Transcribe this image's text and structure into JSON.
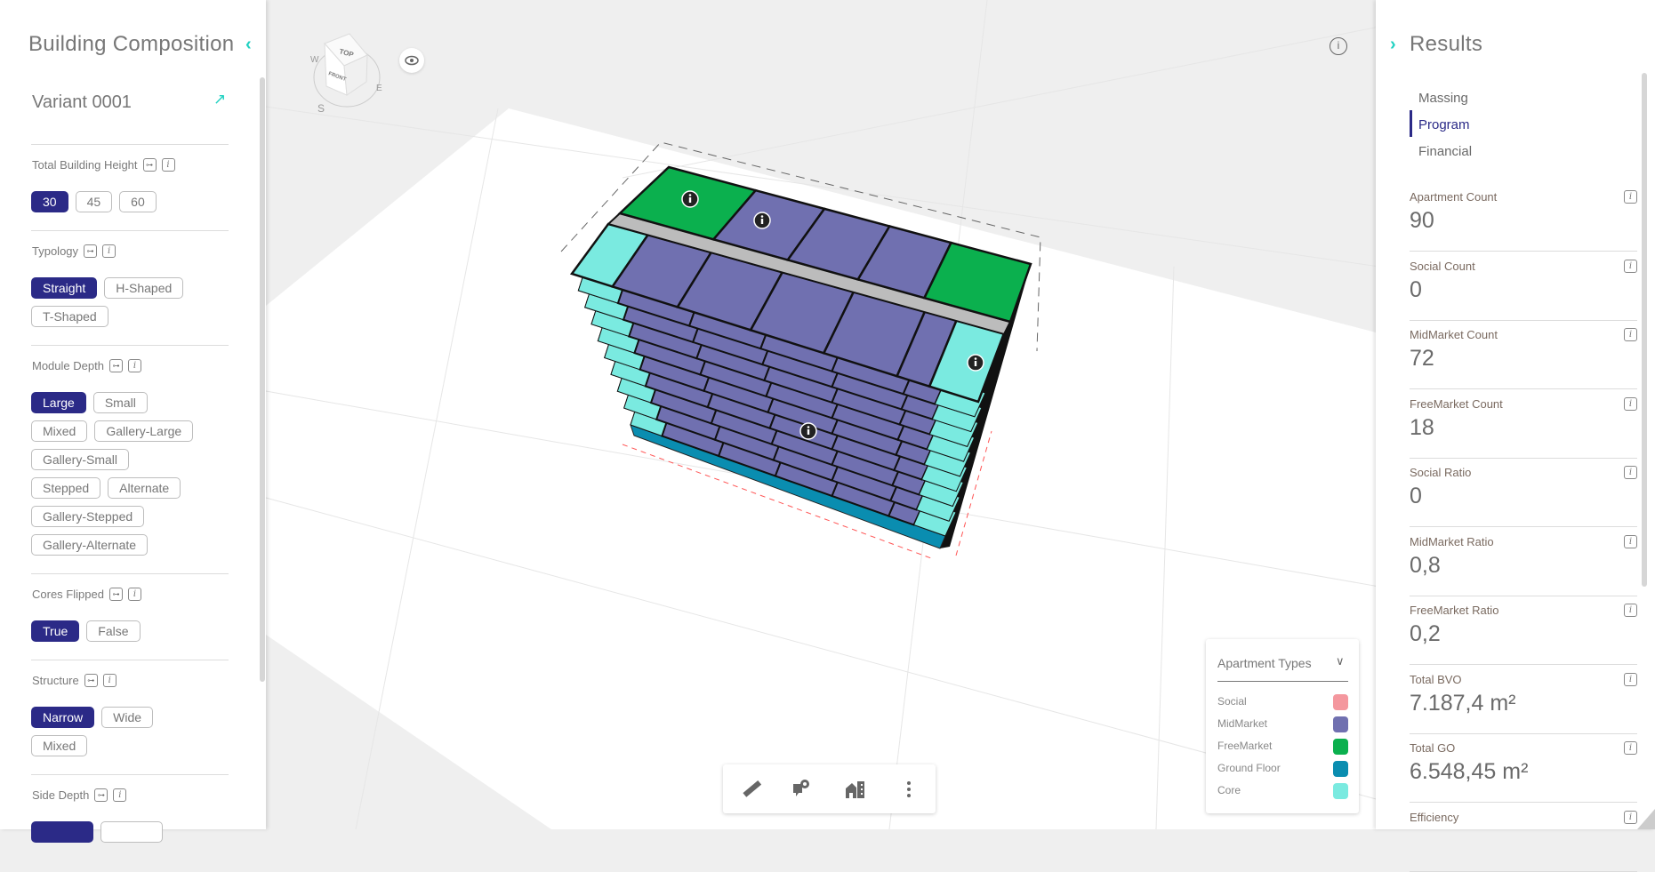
{
  "left_panel": {
    "title": "Building Composition",
    "variant": "Variant 0001",
    "sections": [
      {
        "label": "Total Building Height",
        "options": [
          "30",
          "45",
          "60"
        ],
        "selected": "30"
      },
      {
        "label": "Typology",
        "options": [
          "Straight",
          "H-Shaped",
          "T-Shaped"
        ],
        "selected": "Straight"
      },
      {
        "label": "Module Depth",
        "options": [
          "Large",
          "Small",
          "Mixed",
          "Gallery-Large",
          "Gallery-Small",
          "Stepped",
          "Alternate",
          "Gallery-Stepped",
          "Gallery-Alternate"
        ],
        "selected": "Large"
      },
      {
        "label": "Cores Flipped",
        "options": [
          "True",
          "False"
        ],
        "selected": "True"
      },
      {
        "label": "Structure",
        "options": [
          "Narrow",
          "Wide",
          "Mixed"
        ],
        "selected": "Narrow"
      },
      {
        "label": "Side Depth",
        "options": [
          "",
          ""
        ],
        "selected": ""
      }
    ]
  },
  "right_panel": {
    "title": "Results",
    "tabs": [
      "Massing",
      "Program",
      "Financial"
    ],
    "active_tab": "Program",
    "metrics": [
      {
        "label": "Apartment Count",
        "value": "90"
      },
      {
        "label": "Social Count",
        "value": "0"
      },
      {
        "label": "MidMarket Count",
        "value": "72"
      },
      {
        "label": "FreeMarket Count",
        "value": "18"
      },
      {
        "label": "Social Ratio",
        "value": "0"
      },
      {
        "label": "MidMarket Ratio",
        "value": "0,8"
      },
      {
        "label": "FreeMarket Ratio",
        "value": "0,2"
      },
      {
        "label": "Total BVO",
        "value": "7.187,4 m²"
      },
      {
        "label": "Total GO",
        "value": "6.548,45 m²"
      },
      {
        "label": "Efficiency",
        "value": ""
      }
    ]
  },
  "viewcube": {
    "top": "TOP",
    "front": "FRONT",
    "w": "W",
    "e": "E",
    "s": "S"
  },
  "legend": {
    "title": "Apartment Types",
    "items": [
      {
        "label": "Social",
        "color": "#f4979e"
      },
      {
        "label": "MidMarket",
        "color": "#7070b0"
      },
      {
        "label": "FreeMarket",
        "color": "#0bb04e"
      },
      {
        "label": "Ground Floor",
        "color": "#0a8db0"
      },
      {
        "label": "Core",
        "color": "#7aeae0"
      }
    ]
  },
  "toolbar": [
    "ruler-icon",
    "comment-pin-icon",
    "building-icon",
    "more-vert-icon"
  ],
  "colors": {
    "accent": "#2b2a87",
    "teal": "#1fd1c1",
    "corridor": "#bcbcbc"
  }
}
